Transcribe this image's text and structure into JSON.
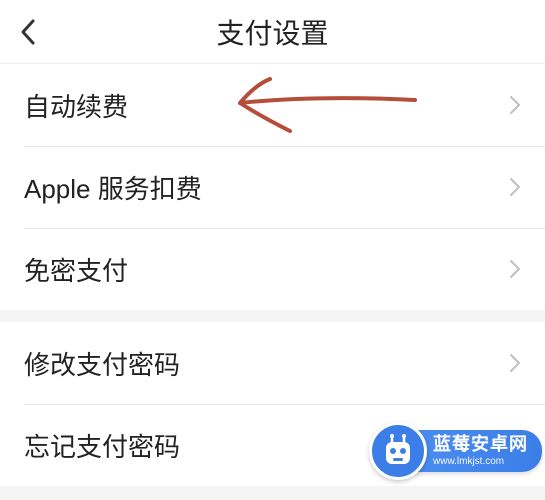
{
  "header": {
    "title": "支付设置"
  },
  "sections": [
    {
      "items": [
        {
          "label": "自动续费"
        },
        {
          "label": "Apple 服务扣费"
        },
        {
          "label": "免密支付"
        }
      ]
    },
    {
      "items": [
        {
          "label": "修改支付密码"
        },
        {
          "label": "忘记支付密码"
        }
      ]
    }
  ],
  "annotation": {
    "color": "#b54d3a"
  },
  "watermark": {
    "name": "蓝莓安卓网",
    "url": "www.lmkjst.com"
  }
}
